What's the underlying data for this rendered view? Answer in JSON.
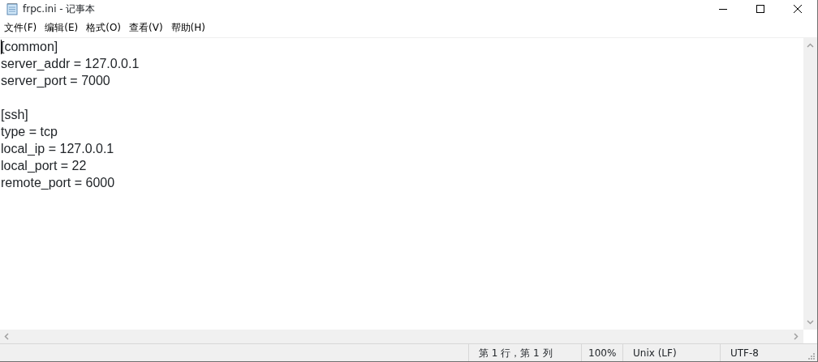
{
  "window": {
    "title": "frpc.ini - 记事本"
  },
  "menu": [
    "文件(F)",
    "编辑(E)",
    "格式(O)",
    "查看(V)",
    "帮助(H)"
  ],
  "editor": {
    "text": "[common]\nserver_addr = 127.0.0.1\nserver_port = 7000\n\n[ssh]\ntype = tcp\nlocal_ip = 127.0.0.1\nlocal_port = 22\nremote_port = 6000"
  },
  "status_bar": [
    "第 1 行，第 1 列",
    "100%",
    "Unix (LF)",
    "UTF-8"
  ]
}
